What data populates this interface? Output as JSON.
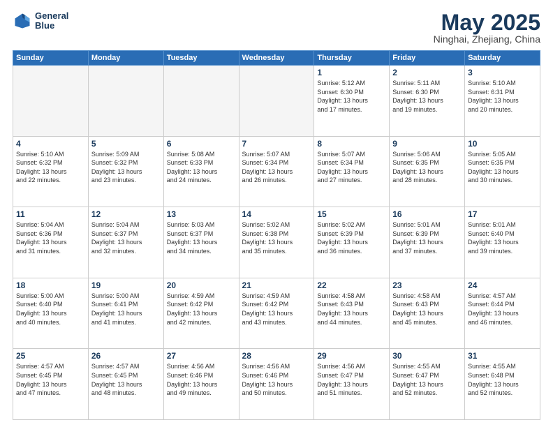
{
  "header": {
    "logo_line1": "General",
    "logo_line2": "Blue",
    "month": "May 2025",
    "location": "Ninghai, Zhejiang, China"
  },
  "weekdays": [
    "Sunday",
    "Monday",
    "Tuesday",
    "Wednesday",
    "Thursday",
    "Friday",
    "Saturday"
  ],
  "weeks": [
    [
      {
        "day": "",
        "info": "",
        "empty": true
      },
      {
        "day": "",
        "info": "",
        "empty": true
      },
      {
        "day": "",
        "info": "",
        "empty": true
      },
      {
        "day": "",
        "info": "",
        "empty": true
      },
      {
        "day": "1",
        "info": "Sunrise: 5:12 AM\nSunset: 6:30 PM\nDaylight: 13 hours\nand 17 minutes.",
        "empty": false
      },
      {
        "day": "2",
        "info": "Sunrise: 5:11 AM\nSunset: 6:30 PM\nDaylight: 13 hours\nand 19 minutes.",
        "empty": false
      },
      {
        "day": "3",
        "info": "Sunrise: 5:10 AM\nSunset: 6:31 PM\nDaylight: 13 hours\nand 20 minutes.",
        "empty": false
      }
    ],
    [
      {
        "day": "4",
        "info": "Sunrise: 5:10 AM\nSunset: 6:32 PM\nDaylight: 13 hours\nand 22 minutes.",
        "empty": false
      },
      {
        "day": "5",
        "info": "Sunrise: 5:09 AM\nSunset: 6:32 PM\nDaylight: 13 hours\nand 23 minutes.",
        "empty": false
      },
      {
        "day": "6",
        "info": "Sunrise: 5:08 AM\nSunset: 6:33 PM\nDaylight: 13 hours\nand 24 minutes.",
        "empty": false
      },
      {
        "day": "7",
        "info": "Sunrise: 5:07 AM\nSunset: 6:34 PM\nDaylight: 13 hours\nand 26 minutes.",
        "empty": false
      },
      {
        "day": "8",
        "info": "Sunrise: 5:07 AM\nSunset: 6:34 PM\nDaylight: 13 hours\nand 27 minutes.",
        "empty": false
      },
      {
        "day": "9",
        "info": "Sunrise: 5:06 AM\nSunset: 6:35 PM\nDaylight: 13 hours\nand 28 minutes.",
        "empty": false
      },
      {
        "day": "10",
        "info": "Sunrise: 5:05 AM\nSunset: 6:35 PM\nDaylight: 13 hours\nand 30 minutes.",
        "empty": false
      }
    ],
    [
      {
        "day": "11",
        "info": "Sunrise: 5:04 AM\nSunset: 6:36 PM\nDaylight: 13 hours\nand 31 minutes.",
        "empty": false
      },
      {
        "day": "12",
        "info": "Sunrise: 5:04 AM\nSunset: 6:37 PM\nDaylight: 13 hours\nand 32 minutes.",
        "empty": false
      },
      {
        "day": "13",
        "info": "Sunrise: 5:03 AM\nSunset: 6:37 PM\nDaylight: 13 hours\nand 34 minutes.",
        "empty": false
      },
      {
        "day": "14",
        "info": "Sunrise: 5:02 AM\nSunset: 6:38 PM\nDaylight: 13 hours\nand 35 minutes.",
        "empty": false
      },
      {
        "day": "15",
        "info": "Sunrise: 5:02 AM\nSunset: 6:39 PM\nDaylight: 13 hours\nand 36 minutes.",
        "empty": false
      },
      {
        "day": "16",
        "info": "Sunrise: 5:01 AM\nSunset: 6:39 PM\nDaylight: 13 hours\nand 37 minutes.",
        "empty": false
      },
      {
        "day": "17",
        "info": "Sunrise: 5:01 AM\nSunset: 6:40 PM\nDaylight: 13 hours\nand 39 minutes.",
        "empty": false
      }
    ],
    [
      {
        "day": "18",
        "info": "Sunrise: 5:00 AM\nSunset: 6:40 PM\nDaylight: 13 hours\nand 40 minutes.",
        "empty": false
      },
      {
        "day": "19",
        "info": "Sunrise: 5:00 AM\nSunset: 6:41 PM\nDaylight: 13 hours\nand 41 minutes.",
        "empty": false
      },
      {
        "day": "20",
        "info": "Sunrise: 4:59 AM\nSunset: 6:42 PM\nDaylight: 13 hours\nand 42 minutes.",
        "empty": false
      },
      {
        "day": "21",
        "info": "Sunrise: 4:59 AM\nSunset: 6:42 PM\nDaylight: 13 hours\nand 43 minutes.",
        "empty": false
      },
      {
        "day": "22",
        "info": "Sunrise: 4:58 AM\nSunset: 6:43 PM\nDaylight: 13 hours\nand 44 minutes.",
        "empty": false
      },
      {
        "day": "23",
        "info": "Sunrise: 4:58 AM\nSunset: 6:43 PM\nDaylight: 13 hours\nand 45 minutes.",
        "empty": false
      },
      {
        "day": "24",
        "info": "Sunrise: 4:57 AM\nSunset: 6:44 PM\nDaylight: 13 hours\nand 46 minutes.",
        "empty": false
      }
    ],
    [
      {
        "day": "25",
        "info": "Sunrise: 4:57 AM\nSunset: 6:45 PM\nDaylight: 13 hours\nand 47 minutes.",
        "empty": false
      },
      {
        "day": "26",
        "info": "Sunrise: 4:57 AM\nSunset: 6:45 PM\nDaylight: 13 hours\nand 48 minutes.",
        "empty": false
      },
      {
        "day": "27",
        "info": "Sunrise: 4:56 AM\nSunset: 6:46 PM\nDaylight: 13 hours\nand 49 minutes.",
        "empty": false
      },
      {
        "day": "28",
        "info": "Sunrise: 4:56 AM\nSunset: 6:46 PM\nDaylight: 13 hours\nand 50 minutes.",
        "empty": false
      },
      {
        "day": "29",
        "info": "Sunrise: 4:56 AM\nSunset: 6:47 PM\nDaylight: 13 hours\nand 51 minutes.",
        "empty": false
      },
      {
        "day": "30",
        "info": "Sunrise: 4:55 AM\nSunset: 6:47 PM\nDaylight: 13 hours\nand 52 minutes.",
        "empty": false
      },
      {
        "day": "31",
        "info": "Sunrise: 4:55 AM\nSunset: 6:48 PM\nDaylight: 13 hours\nand 52 minutes.",
        "empty": false
      }
    ]
  ]
}
